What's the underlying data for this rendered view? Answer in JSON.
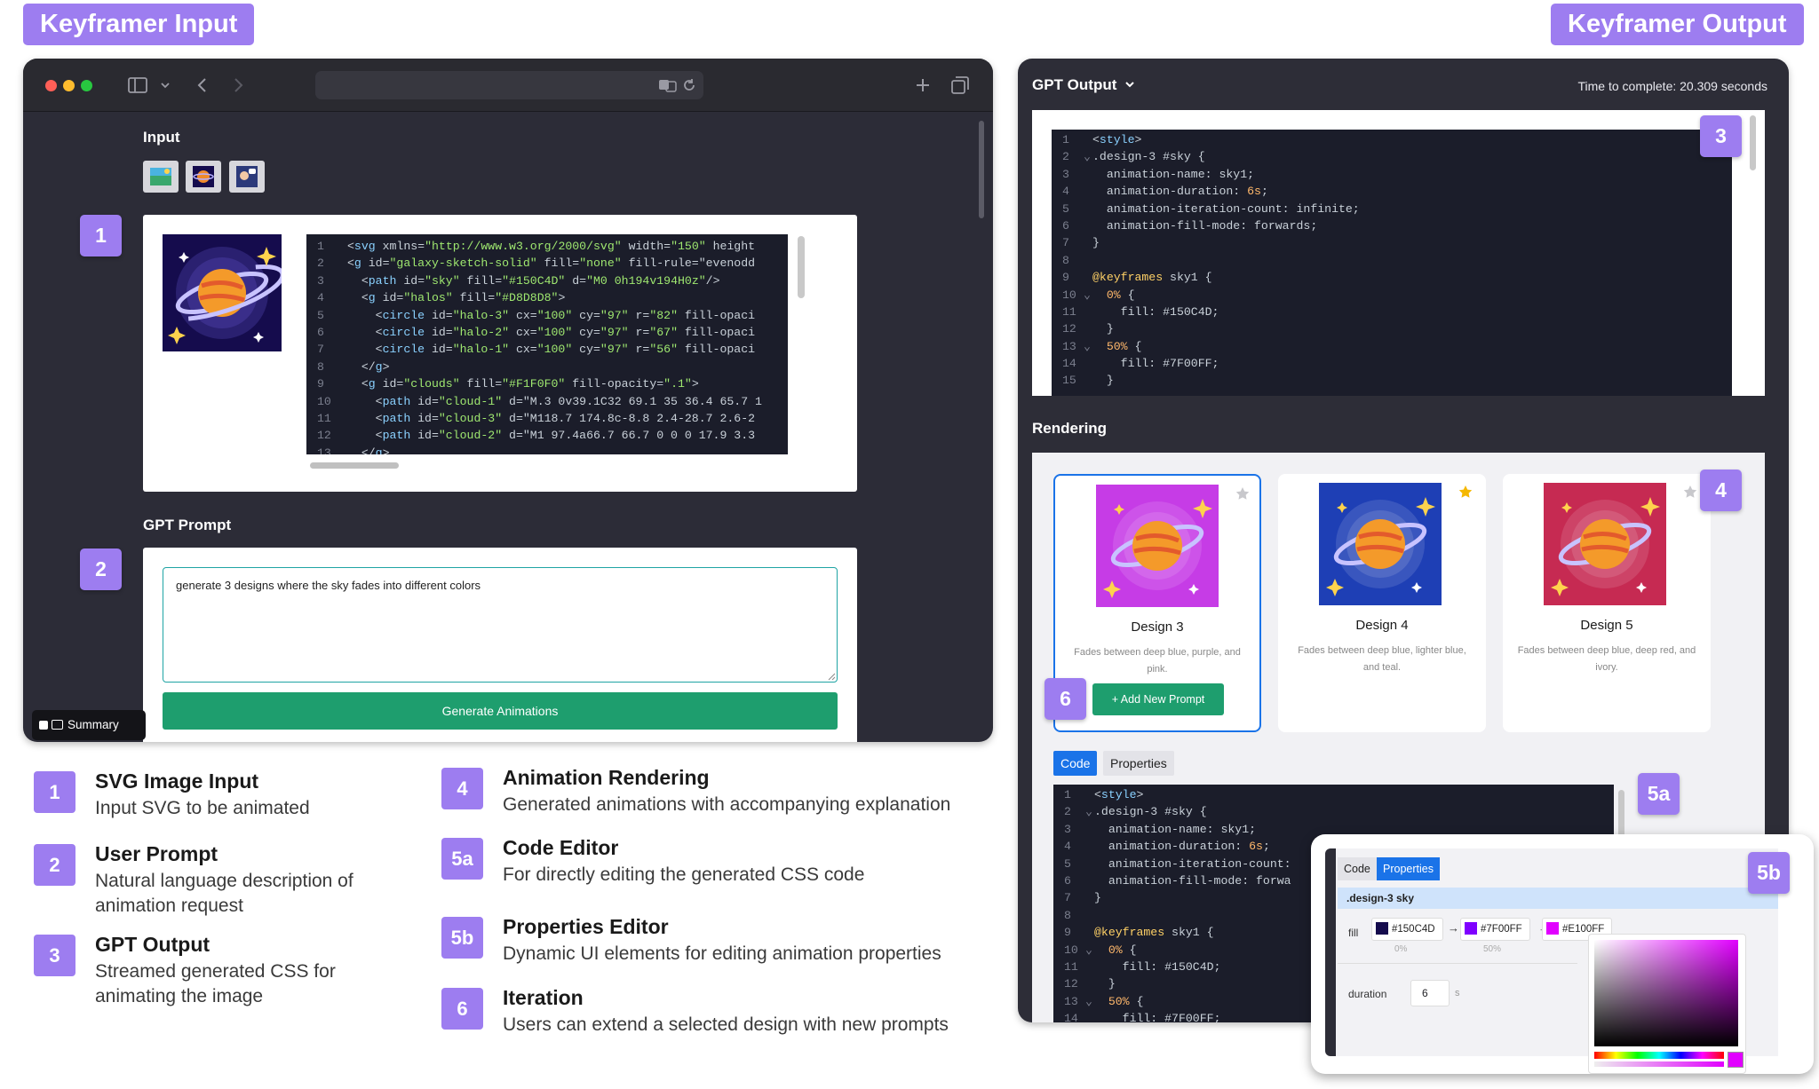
{
  "headers": {
    "input": "Keyframer Input",
    "output": "Keyframer Output"
  },
  "input_window": {
    "input_label": "Input",
    "badge1": "1",
    "badge2": "2",
    "svg_code_lines": [
      "<svg xmlns=\"http://www.w3.org/2000/svg\" width=\"150\" height",
      "<g id=\"galaxy-sketch-solid\" fill=\"none\" fill-rule=\"evenodd",
      "  <path id=\"sky\" fill=\"#150C4D\" d=\"M0 0h194v194H0z\"/>",
      "  <g id=\"halos\" fill=\"#D8D8D8\">",
      "    <circle id=\"halo-3\" cx=\"100\" cy=\"97\" r=\"82\" fill-opaci",
      "    <circle id=\"halo-2\" cx=\"100\" cy=\"97\" r=\"67\" fill-opaci",
      "    <circle id=\"halo-1\" cx=\"100\" cy=\"97\" r=\"56\" fill-opaci",
      "  </g>",
      "  <g id=\"clouds\" fill=\"#F1F0F0\" fill-opacity=\".1\">",
      "    <path id=\"cloud-1\" d=\"M.3 0v39.1C32 69.1 35 36.4 65.7 1",
      "    <path id=\"cloud-3\" d=\"M118.7 174.8c-8.8 2.4-28.7 2.6-2",
      "    <path id=\"cloud-2\" d=\"M1 97.4a66.7 66.7 0 0 0 17.9 3.3",
      "  </g>"
    ],
    "prompt_label": "GPT Prompt",
    "prompt_value": "generate 3 designs where the sky fades into different colors",
    "generate_button": "Generate Animations",
    "summary_label": "Summary"
  },
  "output_window": {
    "gpt_output_label": "GPT Output",
    "time_label": "Time to complete: 20.309 seconds",
    "badge3": "3",
    "rendering_label": "Rendering",
    "badge4": "4",
    "badge5a": "5a",
    "badge5b": "5b",
    "badge6": "6",
    "css_lines": [
      "<style>",
      ".design-3 #sky {",
      "  animation-name: sky1;",
      "  animation-duration: 6s;",
      "  animation-iteration-count: infinite;",
      "  animation-fill-mode: forwards;",
      "}",
      "",
      "@keyframes sky1 {",
      "  0% {",
      "    fill: #150C4D;",
      "  }",
      "  50% {",
      "    fill: #7F00FF;",
      "  }"
    ],
    "designs": [
      {
        "name": "Design 3",
        "desc": "Fades between deep blue, purple, and pink.",
        "bg": "#c63ce6",
        "starred": false
      },
      {
        "name": "Design 4",
        "desc": "Fades between deep blue, lighter blue, and teal.",
        "bg": "#1e3fb5",
        "starred": true
      },
      {
        "name": "Design 5",
        "desc": "Fades between deep blue, deep red, and ivory.",
        "bg": "#c62a52",
        "starred": false
      }
    ],
    "add_prompt_button": "+ Add New Prompt",
    "tabs": {
      "code": "Code",
      "properties": "Properties"
    },
    "editor_lines": [
      "<style>",
      ".design-3 #sky {",
      "  animation-name: sky1;",
      "  animation-duration: 6s;",
      "  animation-iteration-count:",
      "  animation-fill-mode: forwa",
      "}",
      "",
      "@keyframes sky1 {",
      "  0% {",
      "    fill: #150C4D;",
      "  }",
      "  50% {",
      "    fill: #7F00FF;"
    ],
    "props": {
      "selector": ".design-3 sky",
      "fill_label": "fill",
      "stops": [
        {
          "color": "#150C4D",
          "pct": "0%"
        },
        {
          "color": "#7F00FF",
          "pct": "50%"
        },
        {
          "color": "#E100FF",
          "pct": ""
        }
      ],
      "arrow": "→",
      "duration_label": "duration",
      "duration_value": "6",
      "duration_unit": "s"
    }
  },
  "legend": [
    {
      "num": "1",
      "title": "SVG Image Input",
      "desc": "Input SVG to be animated"
    },
    {
      "num": "2",
      "title": "User Prompt",
      "desc": "Natural language description of animation request"
    },
    {
      "num": "3",
      "title": "GPT Output",
      "desc": "Streamed generated CSS for animating the image"
    },
    {
      "num": "4",
      "title": "Animation Rendering",
      "desc": "Generated animations with accompanying explanation"
    },
    {
      "num": "5a",
      "title": "Code Editor",
      "desc": "For directly editing the generated CSS code"
    },
    {
      "num": "5b",
      "title": "Properties Editor",
      "desc": "Dynamic UI elements for editing animation properties"
    },
    {
      "num": "6",
      "title": "Iteration",
      "desc": "Users can extend a selected design with new prompts"
    }
  ],
  "colors": {
    "accent": "#9d7df0",
    "green": "#1e9e6e",
    "blue": "#1a73e8"
  }
}
